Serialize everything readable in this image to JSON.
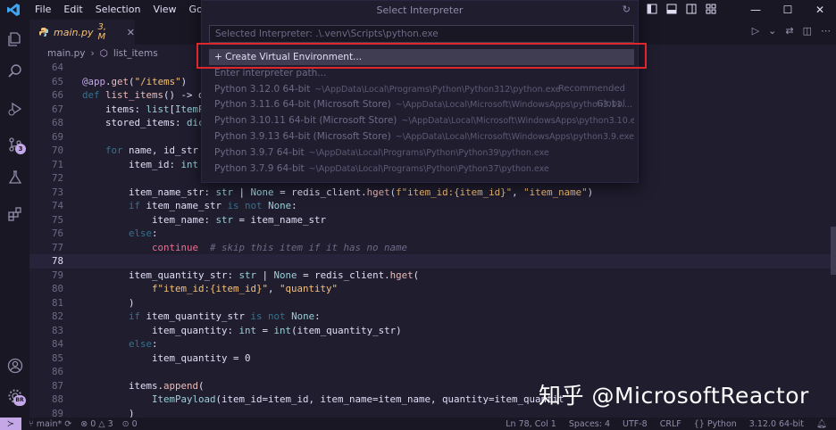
{
  "menu": [
    "File",
    "Edit",
    "Selection",
    "View",
    "Go",
    "..."
  ],
  "tab": {
    "name": "main.py",
    "modifier": "3, M"
  },
  "breadcrumb": {
    "file": "main.py",
    "symbol": "list_items"
  },
  "code_lines": [
    {
      "n": "64",
      "html": ""
    },
    {
      "n": "65",
      "html": "<span class='dec'>@app</span>.<span class='fn'>get</span>(<span class='st'>\"/items\"</span>)"
    },
    {
      "n": "66",
      "html": "<span class='kw'>def</span> <span class='fn'>list_items</span>() -&gt; d"
    },
    {
      "n": "67",
      "html": "    items: <span class='ty'>list</span>[<span class='ty'>ItemP</span>"
    },
    {
      "n": "68",
      "html": "    stored_items: <span class='ty'>dic</span>"
    },
    {
      "n": "69",
      "html": ""
    },
    {
      "n": "70",
      "html": "    <span class='kw'>for</span> name, id_str"
    },
    {
      "n": "71",
      "html": "        item_id: <span class='ty'>int</span> ="
    },
    {
      "n": "72",
      "html": ""
    },
    {
      "n": "73",
      "html": "        item_name_str: <span class='ty'>str</span> | <span class='ty'>None</span> = redis_client.<span class='fn'>hget</span>(<span class='st'>f\"item_id:{item_id}\"</span>, <span class='st'>\"item_name\"</span>)"
    },
    {
      "n": "74",
      "html": "        <span class='kw'>if</span> item_name_str <span class='kw'>is not</span> <span class='ty'>None</span>:"
    },
    {
      "n": "75",
      "html": "            item_name: <span class='ty'>str</span> = item_name_str"
    },
    {
      "n": "76",
      "html": "        <span class='kw'>else</span>:"
    },
    {
      "n": "77",
      "html": "            <span class='kw2'>continue</span>  <span class='cm'># skip this item if it has no name</span>"
    },
    {
      "n": "78",
      "html": "",
      "current": true
    },
    {
      "n": "79",
      "html": "        item_quantity_str: <span class='ty'>str</span> | <span class='ty'>None</span> = redis_client.<span class='fn'>hget</span>("
    },
    {
      "n": "80",
      "html": "            <span class='st'>f\"item_id:{item_id}\"</span>, <span class='st'>\"quantity\"</span>"
    },
    {
      "n": "81",
      "html": "        )"
    },
    {
      "n": "82",
      "html": "        <span class='kw'>if</span> item_quantity_str <span class='kw'>is not</span> <span class='ty'>None</span>:"
    },
    {
      "n": "83",
      "html": "            item_quantity: <span class='ty'>int</span> = <span class='ty'>int</span>(item_quantity_str)"
    },
    {
      "n": "84",
      "html": "        <span class='kw'>else</span>:"
    },
    {
      "n": "85",
      "html": "            item_quantity = <span class='nm'>0</span>"
    },
    {
      "n": "86",
      "html": ""
    },
    {
      "n": "87",
      "html": "        items.<span class='fn'>append</span>("
    },
    {
      "n": "88",
      "html": "            <span class='ty'>ItemPayload</span>(item_id=item_id, item_name=item_name, quantity=item_quantit"
    },
    {
      "n": "89",
      "html": "        )"
    }
  ],
  "quickpick": {
    "title": "Select Interpreter",
    "input_placeholder": "Selected Interpreter: .\\.venv\\Scripts\\python.exe",
    "items": [
      {
        "label": "+ Create Virtual Environment...",
        "path": "",
        "tag": "",
        "selected": true
      },
      {
        "label": "Enter interpreter path...",
        "path": "",
        "tag": ""
      },
      {
        "label": "Python 3.12.0 64-bit",
        "path": "~\\AppData\\Local\\Programs\\Python\\Python312\\python.exe",
        "tag": "Recommended"
      },
      {
        "label": "Python 3.11.6 64-bit (Microsoft Store)",
        "path": "~\\AppData\\Local\\Microsoft\\WindowsApps\\python3.11....",
        "tag": "Global"
      },
      {
        "label": "Python 3.10.11 64-bit (Microsoft Store)",
        "path": "~\\AppData\\Local\\Microsoft\\WindowsApps\\python3.10.exe",
        "tag": ""
      },
      {
        "label": "Python 3.9.13 64-bit (Microsoft Store)",
        "path": "~\\AppData\\Local\\Microsoft\\WindowsApps\\python3.9.exe",
        "tag": ""
      },
      {
        "label": "Python 3.9.7 64-bit",
        "path": "~\\AppData\\Local\\Programs\\Python\\Python39\\python.exe",
        "tag": ""
      },
      {
        "label": "Python 3.7.9 64-bit",
        "path": "~\\AppData\\Local\\Programs\\Python\\Python37\\python.exe",
        "tag": ""
      }
    ]
  },
  "status": {
    "branch": "main*",
    "errors": "0",
    "warnings": "3",
    "ports": "0",
    "position": "Ln 78, Col 1",
    "spaces": "Spaces: 4",
    "encoding": "UTF-8",
    "eol": "CRLF",
    "language": "Python",
    "interpreter": "3.12.0 64-bit"
  },
  "scm_badge": "3",
  "account_initials": "BR",
  "watermark": "知乎 @MicrosoftReactor",
  "colors": {
    "bg": "#191724",
    "editor": "#1f1d2e",
    "accent": "#c4a7e7",
    "highlight_box": "#e0262d"
  }
}
